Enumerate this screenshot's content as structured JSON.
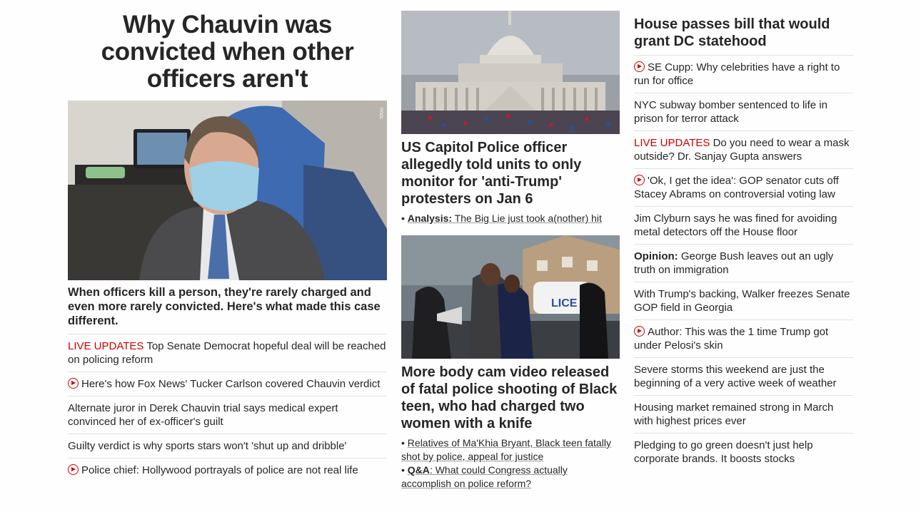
{
  "lead": {
    "title": "Why Chauvin was convicted when other officers aren't",
    "image_alt": "Derek Chauvin wearing a mask in court",
    "pool_label": "POOL",
    "summary": "When officers kill a person, they're rarely charged and even more rarely convicted. Here's what made this case different.",
    "items": [
      {
        "prefix": "LIVE UPDATES",
        "text": " Top Senate Democrat hopeful deal will be reached on policing reform",
        "icon": ""
      },
      {
        "prefix": "",
        "text": "Here's how Fox News' Tucker Carlson covered Chauvin verdict",
        "icon": "play-icon"
      },
      {
        "prefix": "",
        "text": "Alternate juror in Derek Chauvin trial says medical expert convinced her of ex-officer's guilt",
        "icon": ""
      },
      {
        "prefix": "",
        "text": "Guilty verdict is why sports stars won't 'shut up and dribble'",
        "icon": ""
      },
      {
        "prefix": "",
        "text": "Police chief: Hollywood portrayals of police are not real life",
        "icon": "play-icon"
      }
    ]
  },
  "middle": {
    "story1": {
      "title": "US Capitol Police officer allegedly told units to only monitor for 'anti-Trump' protesters on Jan 6",
      "sub_label": "Analysis:",
      "sub_text": " The Big Lie just took a(nother) hit"
    },
    "story2": {
      "title": "More body cam video released of fatal police shooting of Black teen, who had charged two women with a knife",
      "sub1_text": "Relatives of Ma'Khia Bryant, Black teen fatally shot by police, appeal for justice",
      "sub2_label": "Q&A",
      "sub2_text": ": What could Congress actually accomplish on police reform?"
    }
  },
  "right": {
    "title": "House passes bill that would grant DC statehood",
    "items": [
      {
        "prefix": "",
        "bold": "",
        "text": "SE Cupp: Why celebrities have a right to run for office",
        "icon": "play-icon"
      },
      {
        "prefix": "",
        "bold": "",
        "text": "NYC subway bomber sentenced to life in prison for terror attack",
        "icon": ""
      },
      {
        "prefix": "LIVE UPDATES",
        "bold": "",
        "text": " Do you need to wear a mask outside? Dr. Sanjay Gupta answers",
        "icon": ""
      },
      {
        "prefix": "",
        "bold": "",
        "text": "'Ok, I get the idea': GOP senator cuts off Stacey Abrams on controversial voting law",
        "icon": "play-icon"
      },
      {
        "prefix": "",
        "bold": "",
        "text": "Jim Clyburn says he was fined for avoiding metal detectors off the House floor",
        "icon": ""
      },
      {
        "prefix": "",
        "bold": "Opinion:",
        "text": " George Bush leaves out an ugly truth on immigration",
        "icon": ""
      },
      {
        "prefix": "",
        "bold": "",
        "text": "With Trump's backing, Walker freezes Senate GOP field in Georgia",
        "icon": ""
      },
      {
        "prefix": "",
        "bold": "",
        "text": "Author: This was the 1 time Trump got under Pelosi's skin",
        "icon": "play-icon"
      },
      {
        "prefix": "",
        "bold": "",
        "text": "Severe storms this weekend are just the beginning of a very active week of weather",
        "icon": ""
      },
      {
        "prefix": "",
        "bold": "",
        "text": "Housing market remained strong in March with highest prices ever",
        "icon": ""
      },
      {
        "prefix": "",
        "bold": "",
        "text": "Pledging to go green doesn't just help corporate brands. It boosts stocks",
        "icon": ""
      }
    ]
  },
  "colors": {
    "accent": "#cc0000",
    "text": "#262626",
    "divider": "#e1e1e1"
  }
}
